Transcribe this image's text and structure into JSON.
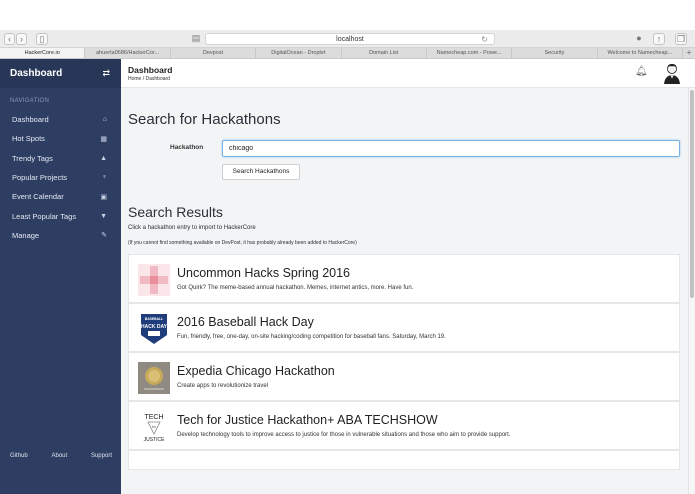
{
  "browser": {
    "url": "localhost",
    "tabs": [
      {
        "label": "HackerCore.io",
        "active": true
      },
      {
        "label": "ahuerta0686/HackerCor...",
        "active": false
      },
      {
        "label": "Devpost",
        "active": false
      },
      {
        "label": "DigitalOcean - Droplet",
        "active": false
      },
      {
        "label": "Domain List",
        "active": false
      },
      {
        "label": "Namecheap.com - Powe...",
        "active": false
      },
      {
        "label": "Security",
        "active": false
      },
      {
        "label": "Welcome to Namecheap...",
        "active": false
      }
    ]
  },
  "sidebar": {
    "title": "Dashboard",
    "toggle_icon": "⇄",
    "nav_label": "NAVIGATION",
    "items": [
      {
        "label": "Dashboard",
        "icon": "⌂"
      },
      {
        "label": "Hot Spots",
        "icon": "▦"
      },
      {
        "label": "Trendy Tags",
        "icon": "▲"
      },
      {
        "label": "Popular Projects",
        "icon": "♆"
      },
      {
        "label": "Event Calendar",
        "icon": "▣"
      },
      {
        "label": "Least Popular Tags",
        "icon": "▼"
      },
      {
        "label": "Manage",
        "icon": "✎"
      }
    ],
    "footer": {
      "github": "Github",
      "about": "About",
      "support": "Support"
    }
  },
  "header": {
    "title": "Dashboard",
    "breadcrumb": "Home / Dashboard"
  },
  "search": {
    "heading": "Search for Hackathons",
    "label": "Hackathon",
    "value": "chicago",
    "button": "Search Hackathons"
  },
  "results": {
    "heading": "Search Results",
    "hint": "Click a hackathon entry to import to HackerCore",
    "hint_sub": "(If you cannot find something available on DevPost, it has probably already been added to HackerCore)",
    "items": [
      {
        "title": "Uncommon Hacks Spring 2016",
        "desc": "Got Quirk? The meme-based annual hackathon. Memes, internet antics, more. Have fun."
      },
      {
        "title": "2016 Baseball Hack Day",
        "desc": "Fun, friendly, free, one-day, on-site hacking/coding competition for baseball fans. Saturday, March 19."
      },
      {
        "title": "Expedia Chicago Hackathon",
        "desc": "Create apps to revolutionize travel"
      },
      {
        "title": "Tech for Justice Hackathon+ ABA TECHSHOW",
        "desc": "Develop technology tools to improve access to justice for those in vulnerable situations and those who aim to provide support."
      }
    ],
    "logos": {
      "baseball_top": "BASEBALL",
      "baseball_mid": "HACK DAY",
      "tech_top": "TECH",
      "tech_mid": "for",
      "tech_bottom": "JUSTICE"
    }
  }
}
